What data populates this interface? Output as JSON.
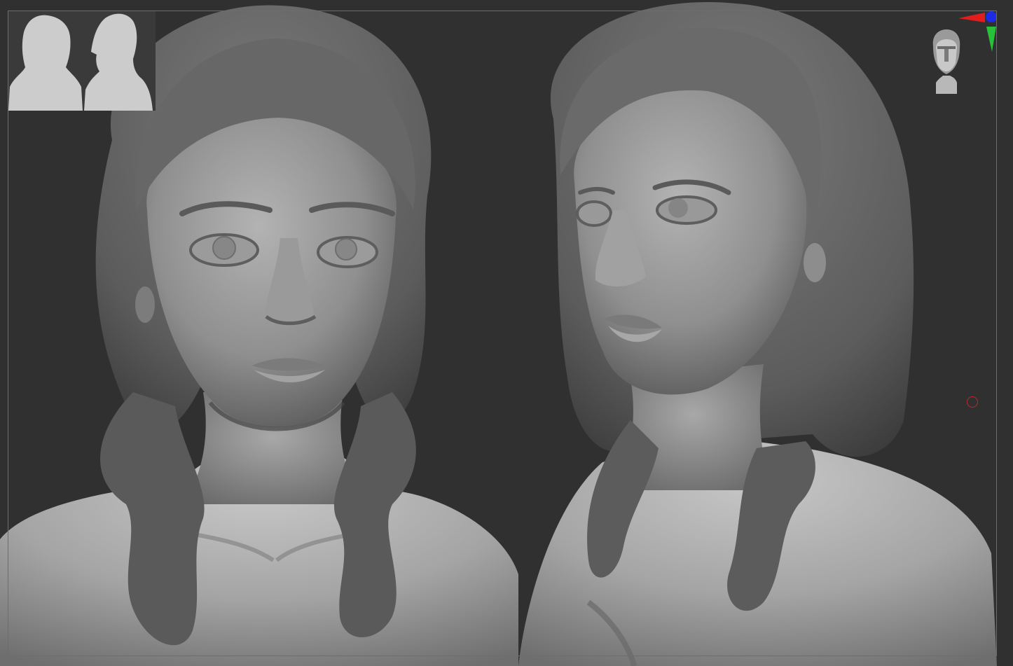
{
  "app": "sculpting-viewport",
  "document": {
    "subject": "female-bust-sculpt",
    "views": [
      "front-view",
      "three-quarter-view"
    ]
  },
  "thumbnail": {
    "silhouettes": [
      "front-silhouette",
      "three-quarter-silhouette"
    ]
  },
  "axis_gizmo": {
    "x_color": "#e11d1d",
    "y_color": "#27c23a",
    "z_color": "#1c2be6"
  },
  "navigation": {
    "icon": "head-navigation-icon"
  },
  "cursor": {
    "color": "#c0282a",
    "icon": "brush-cursor-icon"
  },
  "colors": {
    "background": "#303031",
    "clay_light": "#c9c9c9",
    "clay_mid": "#8c8c8c",
    "clay_dark": "#4e4e4e",
    "frame": "#6d6d6e"
  }
}
